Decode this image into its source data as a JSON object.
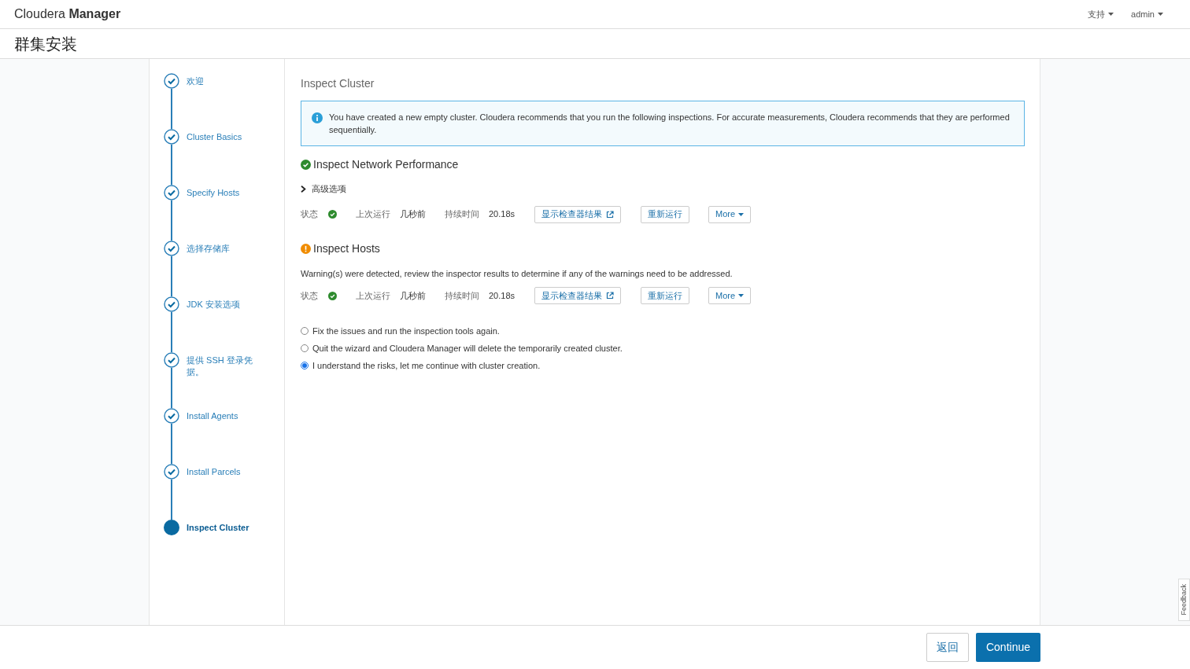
{
  "header": {
    "brand_light": "Cloudera",
    "brand_bold": "Manager",
    "menus": [
      "支持",
      "admin"
    ]
  },
  "page_title": "群集安装",
  "steps": [
    {
      "label": "欢迎",
      "current": false
    },
    {
      "label": "Cluster Basics",
      "current": false
    },
    {
      "label": "Specify Hosts",
      "current": false
    },
    {
      "label": "选择存储库",
      "current": false
    },
    {
      "label": "JDK 安装选项",
      "current": false
    },
    {
      "label": "提供 SSH 登录凭据。",
      "current": false
    },
    {
      "label": "Install Agents",
      "current": false
    },
    {
      "label": "Install Parcels",
      "current": false
    },
    {
      "label": "Inspect Cluster",
      "current": true
    }
  ],
  "content": {
    "title": "Inspect Cluster",
    "info": "You have created a new empty cluster. Cloudera recommends that you run the following inspections. For accurate measurements, Cloudera recommends that they are performed sequentially.",
    "inspections": [
      {
        "title": "Inspect Network Performance",
        "kind": "success",
        "advanced": {
          "label": "高级选项",
          "expanded": false
        },
        "status_label": "状态",
        "passed": true,
        "last_run_label": "上次运行",
        "last_run": "几秒前",
        "duration_label": "持续时间",
        "duration": "20.18s",
        "buttons": [
          "显示检查器结果",
          "重新运行",
          "More"
        ]
      },
      {
        "title": "Inspect Hosts",
        "kind": "warning",
        "message": "Warning(s) were detected, review the inspector results to determine if any of the warnings need to be addressed.",
        "status_label": "状态",
        "passed": true,
        "last_run_label": "上次运行",
        "last_run": "几秒前",
        "duration_label": "持续时间",
        "duration": "20.18s",
        "buttons": [
          "显示检查器结果",
          "重新运行",
          "More"
        ]
      }
    ],
    "options": [
      {
        "label": "Fix the issues and run the inspection tools again.",
        "selected": false
      },
      {
        "label": "Quit the wizard and Cloudera Manager will delete the temporarily created cluster.",
        "selected": false
      },
      {
        "label": "I understand the risks, let me continue with cluster creation.",
        "selected": true
      }
    ]
  },
  "feedback": "Feedback",
  "footer": {
    "back": "返回",
    "continue": "Continue"
  }
}
